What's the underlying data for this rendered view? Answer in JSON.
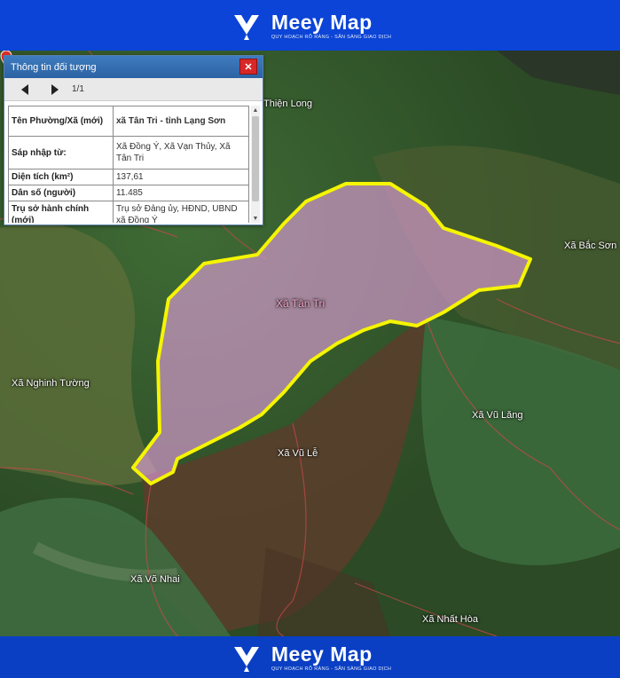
{
  "brand": {
    "name": "Meey Map",
    "tagline": "QUY HOẠCH RÕ RÀNG - SẴN SÀNG GIAO DỊCH"
  },
  "map": {
    "target_label": "Xã Tân Tri",
    "places": {
      "thien_long": "Thiện Long",
      "bac_son": "Xã Bắc Sơn",
      "nghinh_tuong": "Xã Nghinh Tường",
      "vu_lang": "Xã Vũ Lăng",
      "vu_le": "Xã Vũ Lễ",
      "vo_nhai": "Xã Võ Nhai",
      "nhat_hoa": "Xã Nhất Hòa"
    },
    "colors": {
      "boundary": "#f5f500",
      "fill": "#e7a0e0"
    }
  },
  "panel": {
    "title": "Thông tin đối tượng",
    "close": "✕",
    "page": "1/1",
    "rows": [
      {
        "key": "Tên Phường/Xã (mới)",
        "value": "xã Tân Tri - tỉnh Lạng Sơn"
      },
      {
        "key": "Sáp nhập từ:",
        "value": "Xã Đồng Ý, Xã Vạn Thủy, Xã Tân Tri"
      },
      {
        "key": "Diện tích (km²)",
        "value": "137,61"
      },
      {
        "key": "Dân số (người)",
        "value": "11.485"
      },
      {
        "key": "Trụ sở hành chính (mới)",
        "value": "Trụ sở Đảng ủy, HĐND, UBND xã Đồng Ý"
      }
    ]
  }
}
